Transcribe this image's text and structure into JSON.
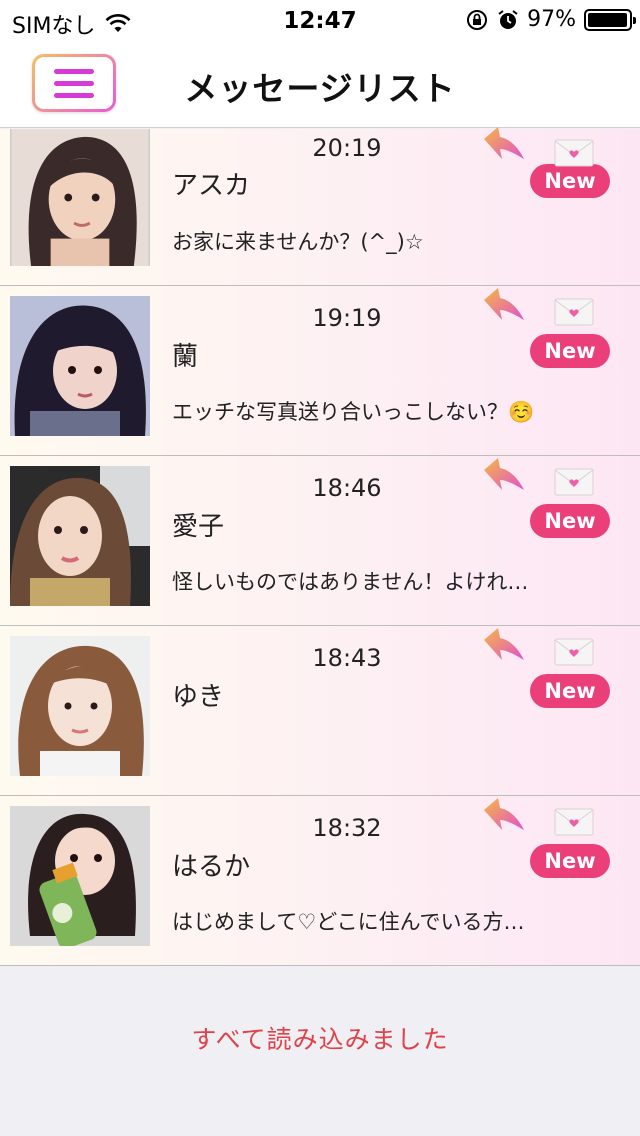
{
  "status_bar": {
    "carrier": "SIMなし",
    "time": "12:47",
    "battery_percent": "97%",
    "battery_level": 0.97,
    "icons": [
      "wifi-icon",
      "orientation-lock-icon",
      "alarm-icon",
      "battery-icon"
    ]
  },
  "nav": {
    "title": "メッセージリスト",
    "menu_icon": "hamburger-menu-icon"
  },
  "messages": [
    {
      "time": "20:19",
      "name": "アスカ",
      "preview": "お家に来ませんか？(^_)☆",
      "badge": "New"
    },
    {
      "time": "19:19",
      "name": "蘭",
      "preview": "エッチな写真送り合いっこしない？☺️",
      "badge": "New"
    },
    {
      "time": "18:46",
      "name": "愛子",
      "preview": "怪しいものではありません！よけれ…",
      "badge": "New"
    },
    {
      "time": "18:43",
      "name": "ゆき",
      "preview": "",
      "badge": "New"
    },
    {
      "time": "18:32",
      "name": "はるか",
      "preview": "はじめまして♡どこに住んでいる方…",
      "badge": "New"
    }
  ],
  "footer": {
    "status": "すべて読み込みました"
  },
  "colors": {
    "accent_pink": "#ea3f79",
    "menu_magenta": "#d63bd8",
    "footer_red": "#e0424a"
  }
}
